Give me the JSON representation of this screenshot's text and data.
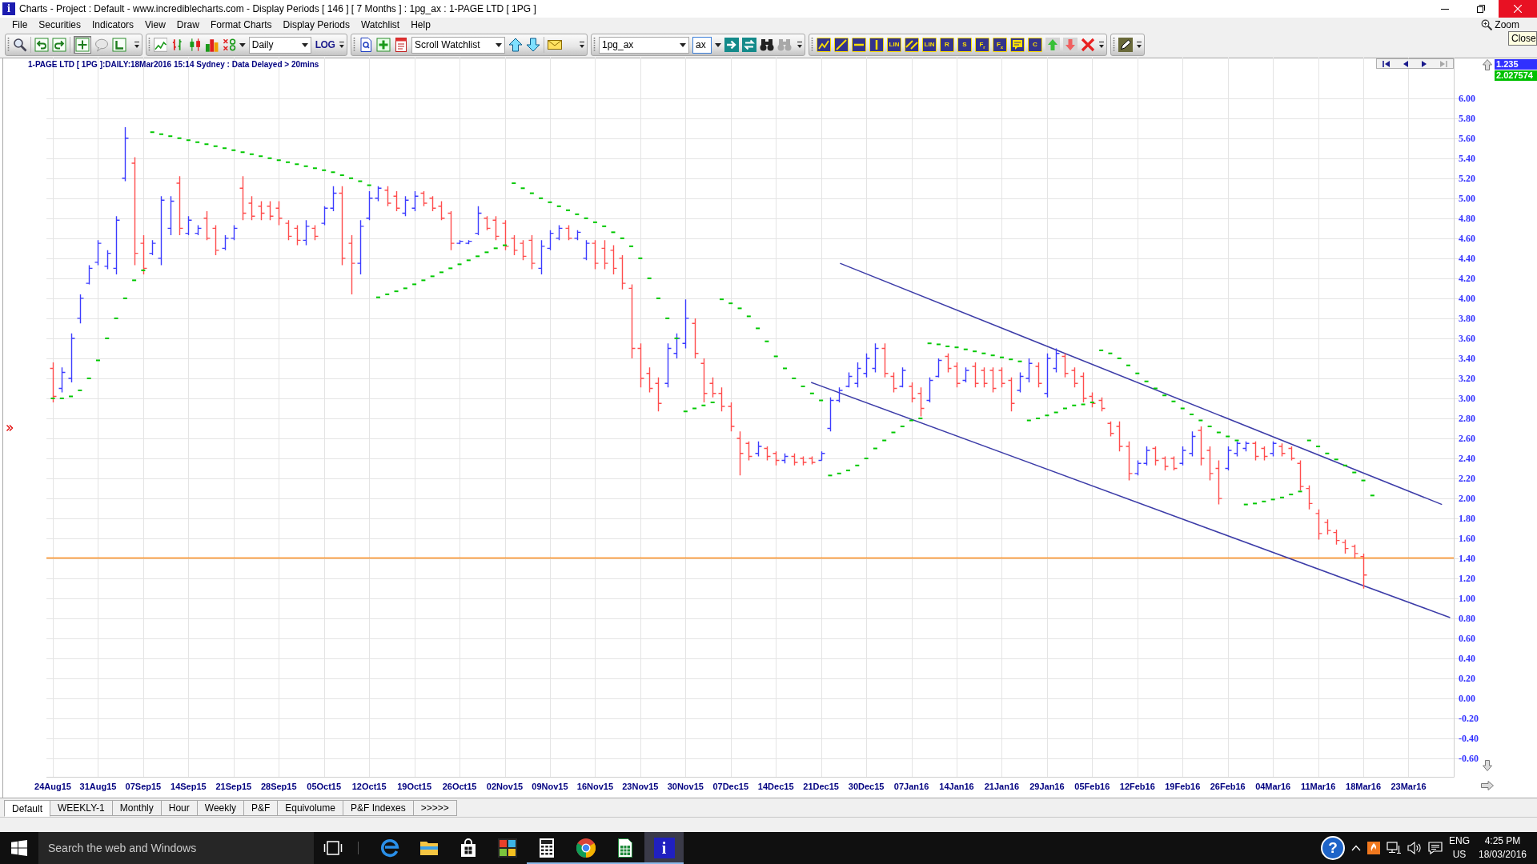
{
  "window": {
    "logo": "i",
    "title": "Charts - Project : Default - www.incrediblecharts.com - Display Periods [ 146 ] [ 7 Months ] : 1pg_ax : 1-PAGE LTD [ 1PG ]"
  },
  "menu": [
    "File",
    "Securities",
    "Indicators",
    "View",
    "Draw",
    "Format Charts",
    "Display Periods",
    "Watchlist",
    "Help"
  ],
  "zoom_button": "Zoom",
  "tooltip": "Close",
  "toolbar": {
    "crosshair": {
      "selected": true
    },
    "period": "Daily",
    "scale": "LOG",
    "watchlist": "Scroll Watchlist",
    "security": "1pg_ax",
    "exchange": "ax",
    "tool_labels": [
      "LIN",
      "LIN",
      "R",
      "S",
      "F$_{r}$",
      "F$_{x}$",
      "C"
    ]
  },
  "chart": {
    "title": "1-PAGE LTD [ 1PG ]:DAILY:18Mar2016 15:14 Sydney : Data Delayed > 20mins",
    "nav_buttons": [
      {
        "disabled": false
      },
      {
        "disabled": false
      },
      {
        "disabled": false
      },
      {
        "disabled": true
      }
    ],
    "last_price": "1.235",
    "indicator_value": "2.027574",
    "y_axis_labels": [
      "6.00",
      "5.80",
      "5.60",
      "5.40",
      "5.20",
      "5.00",
      "4.80",
      "4.60",
      "4.40",
      "4.20",
      "4.00",
      "3.80",
      "3.60",
      "3.40",
      "3.20",
      "3.00",
      "2.80",
      "2.60",
      "2.40",
      "2.20",
      "2.00",
      "1.80",
      "1.60",
      "1.40",
      "1.20",
      "1.00",
      "0.80",
      "0.60",
      "0.40",
      "0.20",
      "0.00",
      "-0.20",
      "-0.40",
      "-0.60"
    ],
    "x_axis_labels": [
      "24Aug15",
      "31Aug15",
      "07Sep15",
      "14Sep15",
      "21Sep15",
      "28Sep15",
      "05Oct15",
      "12Oct15",
      "19Oct15",
      "26Oct15",
      "02Nov15",
      "09Nov15",
      "16Nov15",
      "23Nov15",
      "30Nov15",
      "07Dec15",
      "14Dec15",
      "21Dec15",
      "30Dec15",
      "07Jan16",
      "14Jan16",
      "21Jan16",
      "29Jan16",
      "05Feb16",
      "12Feb16",
      "19Feb16",
      "26Feb16",
      "04Mar16",
      "11Mar16",
      "18Mar16",
      "23Mar16"
    ]
  },
  "period_tabs": [
    {
      "label": "Default",
      "selected": true
    },
    {
      "label": "WEEKLY-1",
      "selected": false
    },
    {
      "label": "Monthly",
      "selected": false
    },
    {
      "label": "Hour",
      "selected": false
    },
    {
      "label": "Weekly",
      "selected": false
    },
    {
      "label": "P&F",
      "selected": false
    },
    {
      "label": "Equivolume",
      "selected": false
    },
    {
      "label": "P&F Indexes",
      "selected": false
    },
    {
      "label": ">>>>>",
      "selected": false
    }
  ],
  "taskbar": {
    "search": {
      "placeholder": "Search the web and Windows"
    },
    "apps": [
      {
        "running": false,
        "selected": false
      },
      {
        "running": false,
        "selected": false
      },
      {
        "running": false,
        "selected": false
      },
      {
        "running": false,
        "selected": false
      },
      {
        "running": true,
        "selected": false
      },
      {
        "running": true,
        "selected": false
      },
      {
        "running": true,
        "selected": false
      },
      {
        "running": true,
        "selected": true,
        "logo": "i"
      }
    ],
    "help": "?",
    "language": "ENG",
    "keyboard_layout": "US",
    "time": "4:25 PM",
    "date": "18/03/2016"
  }
}
